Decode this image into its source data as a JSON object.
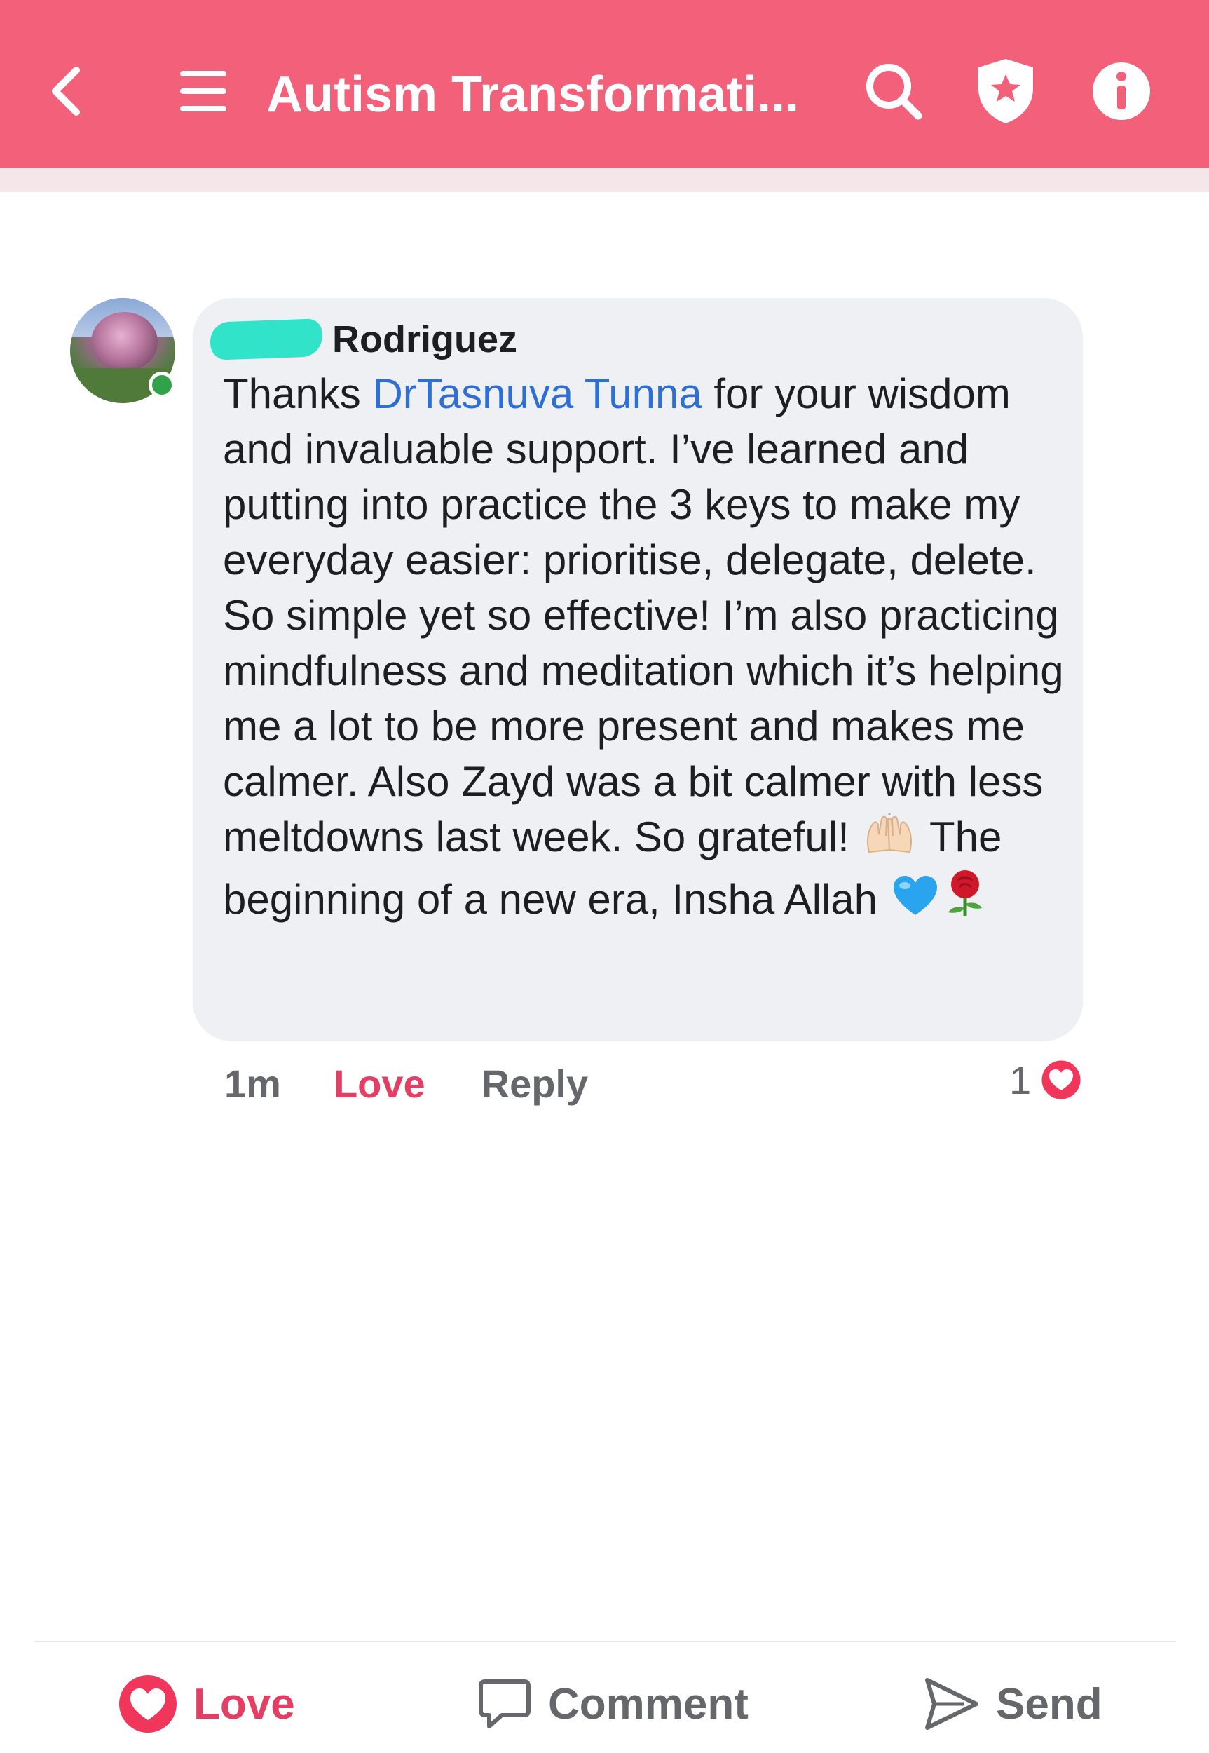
{
  "header": {
    "title": "Autism Transformati...",
    "icons": [
      "back-arrow-icon",
      "menu-icon",
      "search-icon",
      "shield-star-icon",
      "info-icon"
    ],
    "color": "#f2607a"
  },
  "comment": {
    "author": "Rodriguez",
    "text_before_mention": "Thanks ",
    "mention": "DrTasnuva Tunna",
    "text_after_mention": " for your wisdom and invaluable support. I’ve learned and putting into practice the 3 keys to make my everyday easier: prioritise, delegate, delete. So simple yet so effective! I’m also practicing mindfulness and meditation which it’s helping me a lot to be more present and makes me calmer. Also Zayd was a bit calmer with less meltdowns last week. So grateful!",
    "text_after_hands": " The beginning of a new era, Insha Allah",
    "time": "1m",
    "love_label": "Love",
    "reply_label": "Reply",
    "reaction_count": "1",
    "mention_color": "#2f6fd3"
  },
  "bottom_bar": {
    "love_label": "Love",
    "comment_label": "Comment",
    "send_label": "Send",
    "accent_color": "#e33e63"
  }
}
